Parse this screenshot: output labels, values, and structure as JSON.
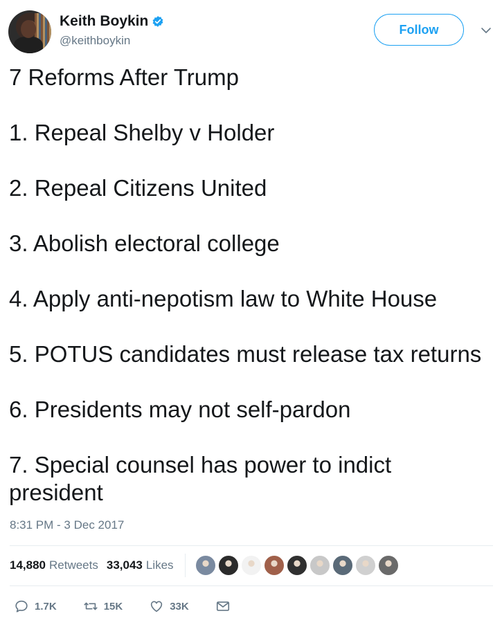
{
  "author": {
    "name": "Keith Boykin",
    "handle": "@keithboykin",
    "verified": true
  },
  "follow_label": "Follow",
  "tweet": {
    "title": "7 Reforms After Trump",
    "items": [
      "1. Repeal Shelby v Holder",
      "2. Repeal Citizens United",
      "3. Abolish electoral college",
      "4. Apply anti-nepotism law to White House",
      "5. POTUS candidates must release tax returns",
      "6. Presidents may not self-pardon",
      "7. Special counsel has power to indict president"
    ]
  },
  "timestamp": "8:31 PM - 3 Dec 2017",
  "stats": {
    "retweets_count": "14,880",
    "retweets_label": "Retweets",
    "likes_count": "33,043",
    "likes_label": "Likes"
  },
  "likers": [
    {
      "icon": "liker-avatar-1",
      "color": "#7a8aa0"
    },
    {
      "icon": "liker-avatar-2",
      "color": "#2b2b2b"
    },
    {
      "icon": "liker-avatar-3",
      "color": "#f2f2f2"
    },
    {
      "icon": "liker-avatar-4",
      "color": "#a0604a"
    },
    {
      "icon": "liker-avatar-5",
      "color": "#303030"
    },
    {
      "icon": "liker-avatar-6",
      "color": "#c8c8c8"
    },
    {
      "icon": "liker-avatar-7",
      "color": "#5a6a78"
    },
    {
      "icon": "liker-avatar-8",
      "color": "#d0d0d0"
    },
    {
      "icon": "liker-avatar-9",
      "color": "#6a6a6a"
    }
  ],
  "actions": {
    "replies": "1.7K",
    "retweets": "15K",
    "likes": "33K"
  },
  "colors": {
    "accent": "#1da1f2",
    "text": "#14171a",
    "secondary": "#657786"
  }
}
